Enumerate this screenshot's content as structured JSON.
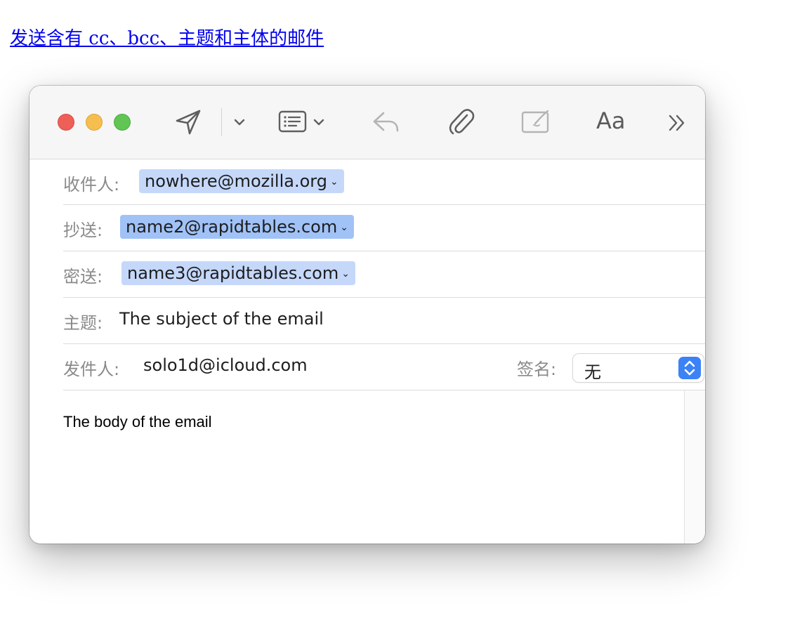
{
  "page": {
    "link_text": "发送含有 cc、bcc、主题和主体的邮件"
  },
  "colors": {
    "link": "#0000ee",
    "close": "#ee5f57",
    "minimize": "#f6be4f",
    "maximize": "#61c554",
    "token": "#c5d8fa",
    "token_selected": "#a0c2f6",
    "stepper": "#3b82f6"
  },
  "toolbar": {
    "icons": [
      "send-icon",
      "chevron-down-icon",
      "header-fields-icon",
      "chevron-down-icon",
      "reply-icon",
      "paperclip-icon",
      "markup-icon",
      "format-icon",
      "more-icon"
    ],
    "format_label": "Aa",
    "more_label": "»"
  },
  "compose": {
    "to": {
      "label": "收件人:",
      "value": "nowhere@mozilla.org"
    },
    "cc": {
      "label": "抄送:",
      "value": "name2@rapidtables.com"
    },
    "bcc": {
      "label": "密送:",
      "value": "name3@rapidtables.com"
    },
    "subject": {
      "label": "主题:",
      "value": "The subject of the email"
    },
    "from": {
      "label": "发件人:",
      "value": "solo1d@icloud.com"
    },
    "signature": {
      "label": "签名:",
      "value": "无"
    },
    "body": "The body of the email"
  }
}
